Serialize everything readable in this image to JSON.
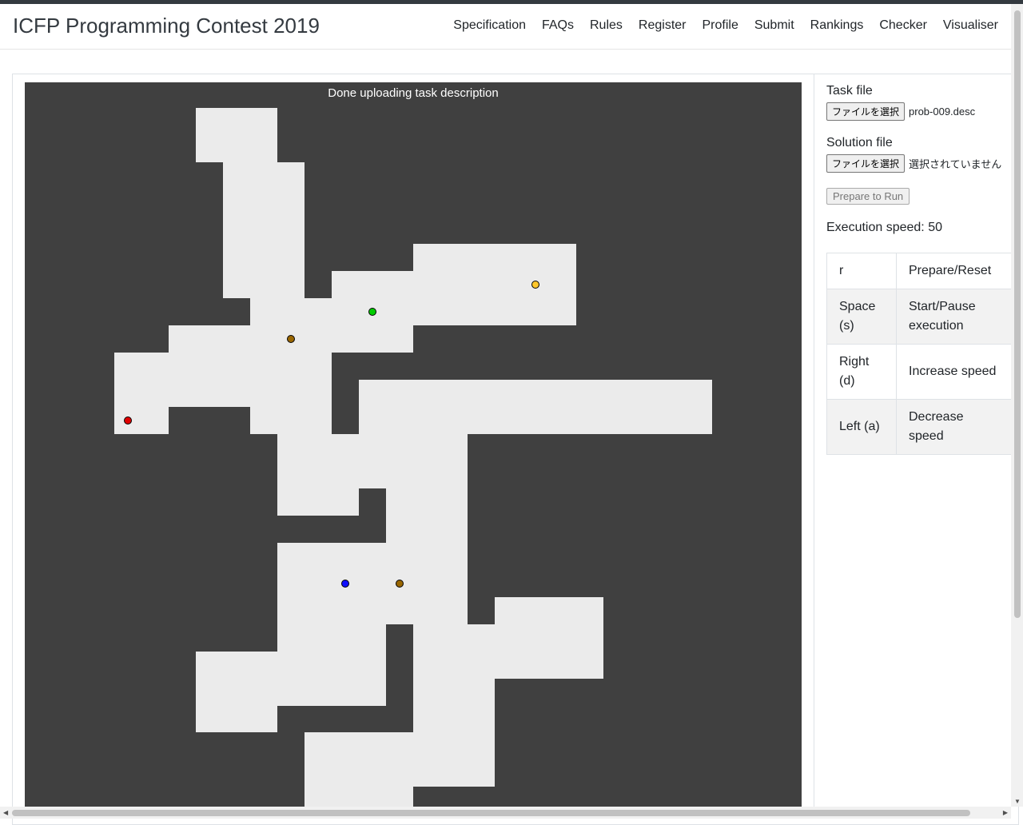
{
  "brand": "ICFP Programming Contest 2019",
  "nav": [
    "Specification",
    "FAQs",
    "Rules",
    "Register",
    "Profile",
    "Submit",
    "Rankings",
    "Checker",
    "Visualiser"
  ],
  "status_text": "Done uploading task description",
  "task_file": {
    "label": "Task file",
    "button": "ファイルを選択",
    "value": "prob-009.desc"
  },
  "solution_file": {
    "label": "Solution file",
    "button": "ファイルを選択",
    "value": "選択されていません"
  },
  "prepare_button": "Prepare to Run",
  "execution_speed": "Execution speed: 50",
  "shortcuts": [
    {
      "key": "r",
      "action": "Prepare/Reset"
    },
    {
      "key": "Space (s)",
      "action": "Start/Pause execution"
    },
    {
      "key": "Right (d)",
      "action": "Increase speed"
    },
    {
      "key": "Left (a)",
      "action": "Decrease speed"
    }
  ],
  "colors": {
    "wall": "#404040",
    "free": "#ebebeb",
    "robot": "#e00000",
    "booster_b": "#ffc72c",
    "booster_f": "#996600",
    "booster_x": "#1010ff",
    "booster_l": "#00cc00"
  }
}
